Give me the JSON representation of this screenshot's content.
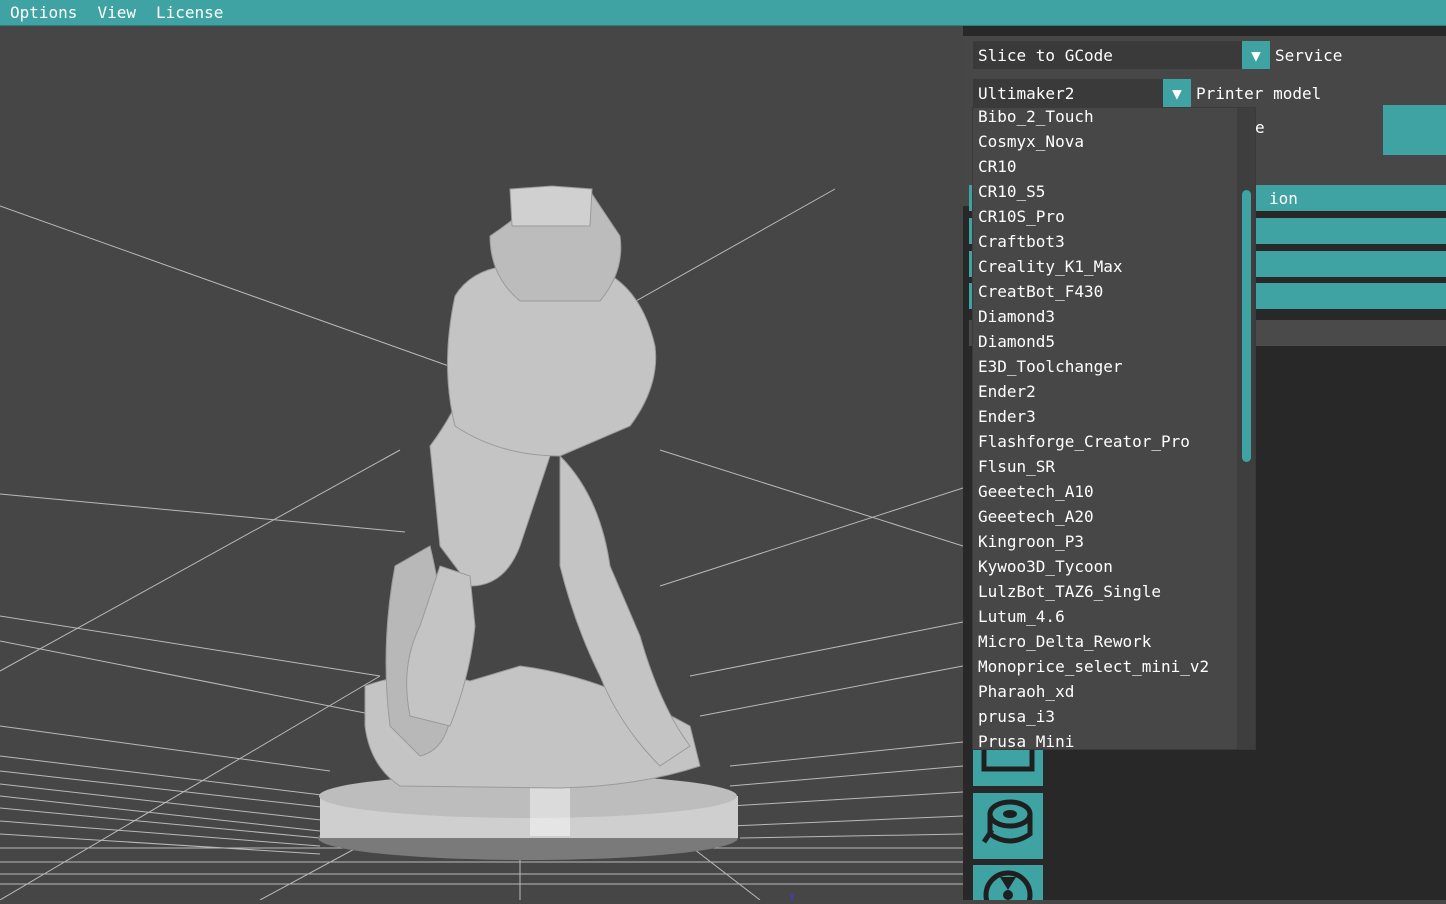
{
  "menu": [
    "Options",
    "View",
    "License"
  ],
  "service": {
    "value": "Slice to GCode",
    "label": "Service"
  },
  "printer": {
    "value": "Ultimaker2",
    "label": "Printer model",
    "options": [
      "Bibo_2_Touch",
      "Cosmyx_Nova",
      "CR10",
      "CR10_S5",
      "CR10S_Pro",
      "Craftbot3",
      "Creality_K1_Max",
      "CreatBot_F430",
      "Diamond3",
      "Diamond5",
      "E3D_Toolchanger",
      "Ender2",
      "Ender3",
      "Flashforge_Creator_Pro",
      "Flsun_SR",
      "Geeetech_A10",
      "Geeetech_A20",
      "Kingroon_P3",
      "Kywoo3D_Tycoon",
      "LulzBot_TAZ6_Single",
      "Lutum_4.6",
      "Micro_Delta_Rework",
      "Monoprice_select_mini_v2",
      "Pharaoh_xd",
      "prusa_i3",
      "Prusa_Mini"
    ]
  },
  "partial": {
    "label_fragment": "e",
    "section_fragment": "ion"
  },
  "icons": {
    "combo_arrow": "triangle-down",
    "tool_1": "box-icon",
    "tool_2": "filament-spool-icon",
    "tool_3": "fan-icon"
  },
  "colors": {
    "accent": "#3fa3a3",
    "background": "#474747",
    "panel_dark": "#282828"
  }
}
